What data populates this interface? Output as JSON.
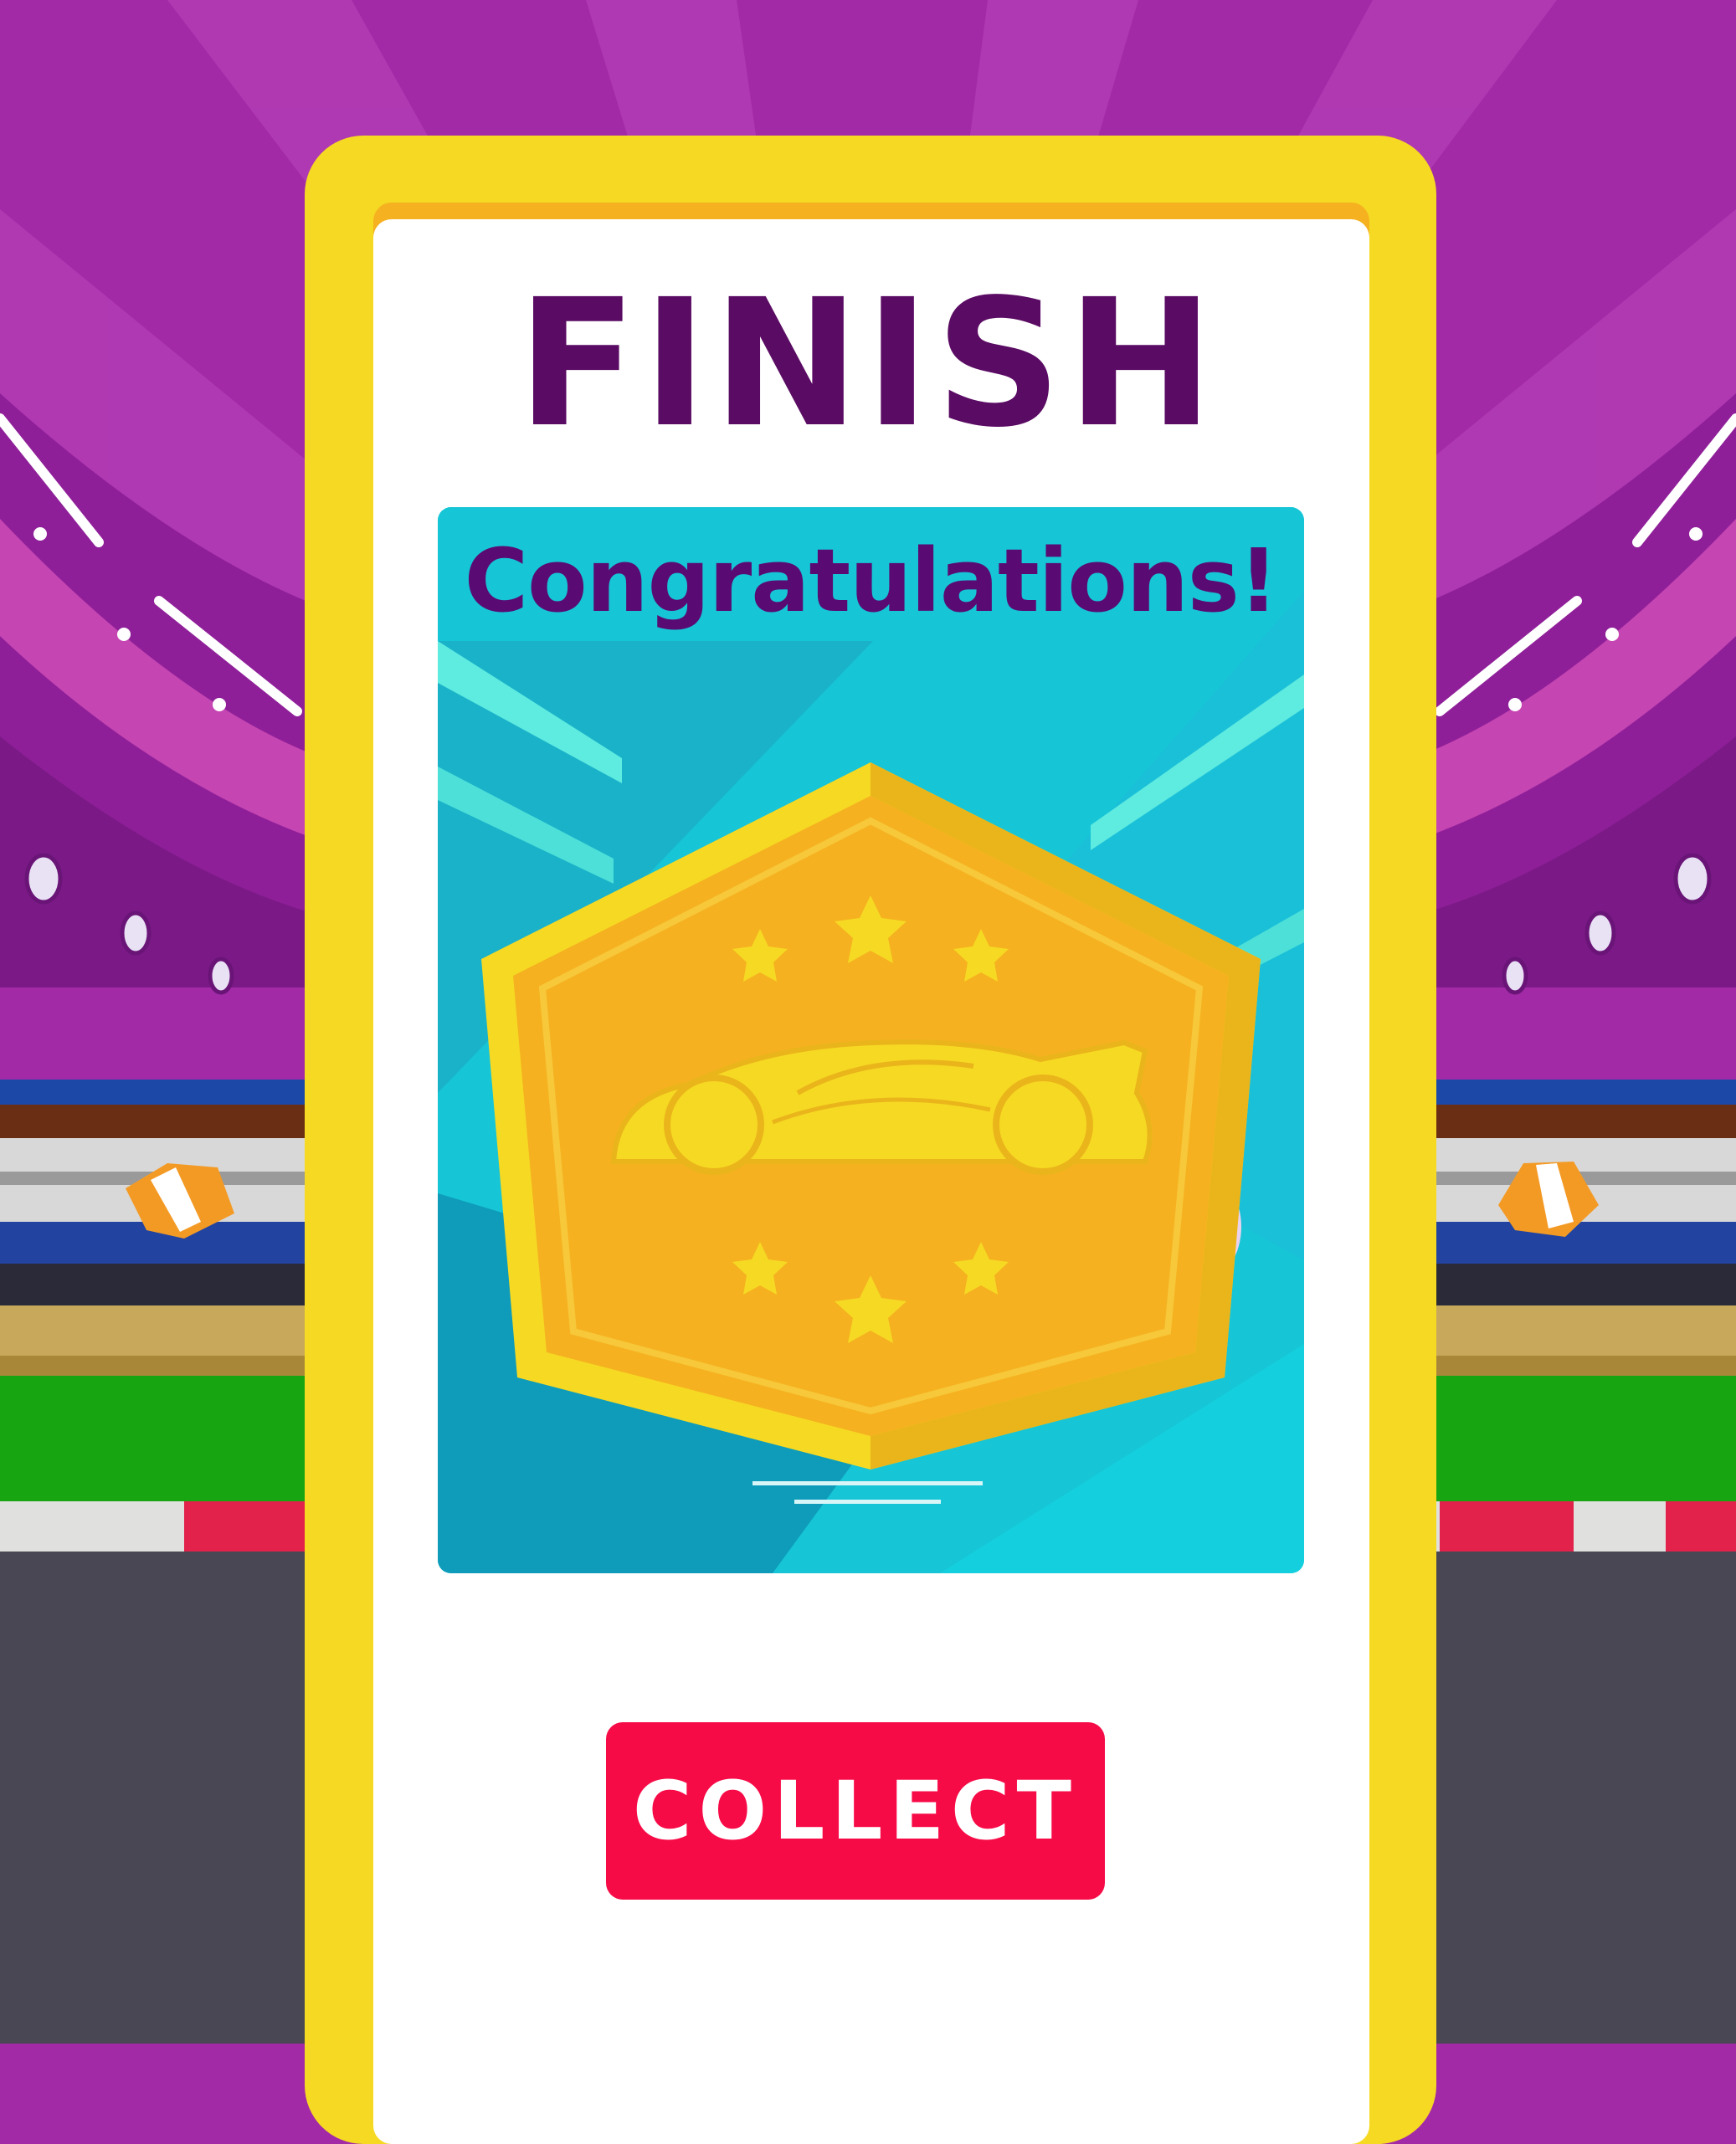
{
  "screen": {
    "title": "FINISH",
    "reward_message": "Congratulations!",
    "collect_label": "COLLECT"
  },
  "colors": {
    "background_purple": "#a22aa6",
    "frame_yellow": "#f6d923",
    "title_purple": "#5a0b63",
    "panel_cyan": "#16c5d6",
    "medal_gold": "#f5b120",
    "button_red": "#f70b47"
  },
  "badge": {
    "stars": 6,
    "emblem": "race-car-icon"
  }
}
